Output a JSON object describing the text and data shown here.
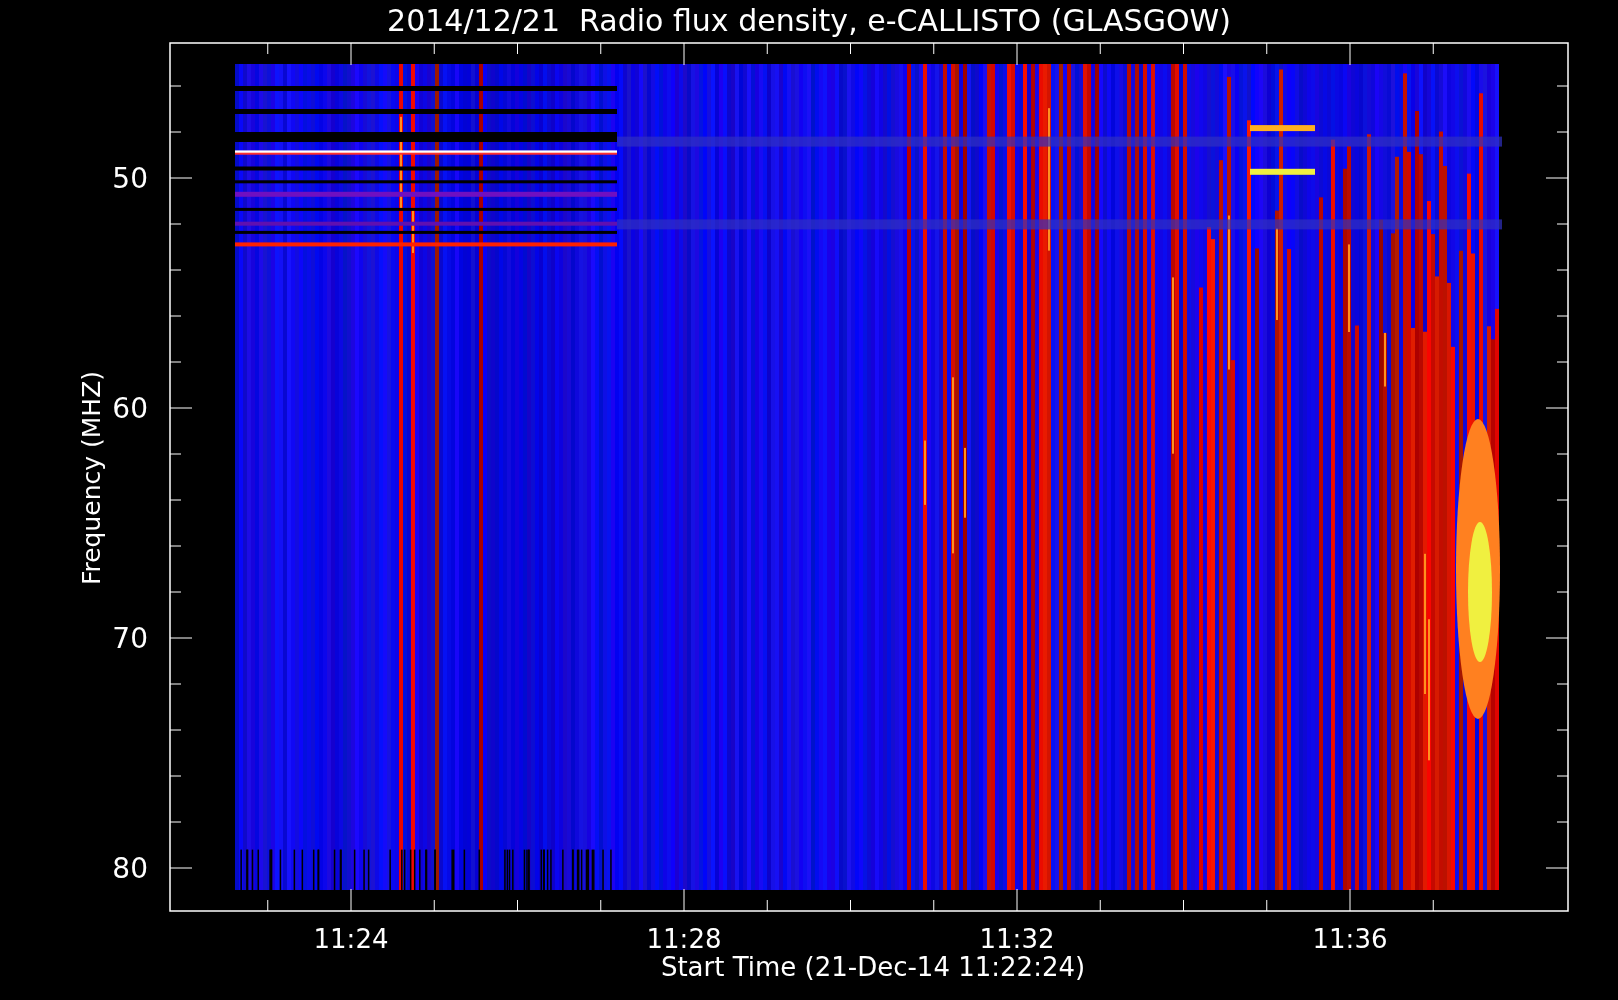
{
  "title": "2014/12/21  Radio flux density, e-CALLISTO (GLASGOW)",
  "y_axis": {
    "label": "Frequency (MHZ)",
    "ticks": [
      "50",
      "60",
      "70",
      "80"
    ]
  },
  "x_axis": {
    "label": "Start Time (21-Dec-14 11:22:24)",
    "ticks": [
      "11:24",
      "11:28",
      "11:32",
      "11:36"
    ]
  }
}
